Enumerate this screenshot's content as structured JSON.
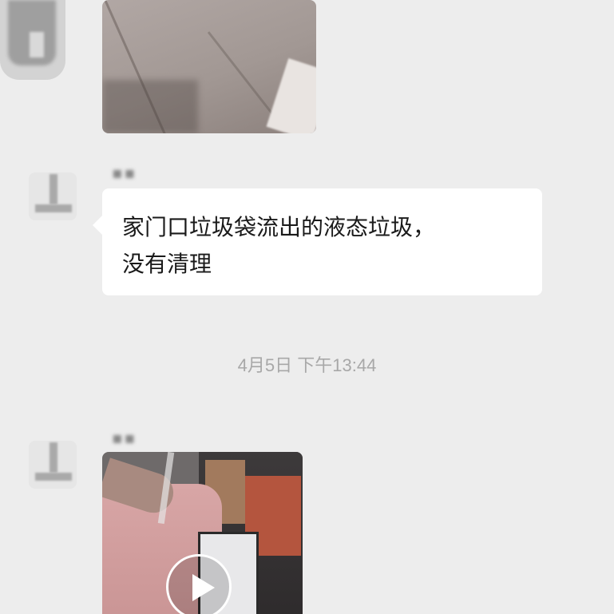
{
  "messages": [
    {
      "type": "image",
      "description_icon": "photo-thumbnail"
    },
    {
      "type": "text",
      "lines": [
        "家门口垃圾袋流出的液态垃圾，",
        "没有清理"
      ]
    },
    {
      "type": "timestamp",
      "text": "4月5日 下午13:44"
    },
    {
      "type": "video",
      "icon": "play-icon"
    }
  ],
  "colors": {
    "background": "#ededed",
    "bubble": "#ffffff",
    "text": "#1a1a1a",
    "timestamp": "#a8a8a8"
  }
}
